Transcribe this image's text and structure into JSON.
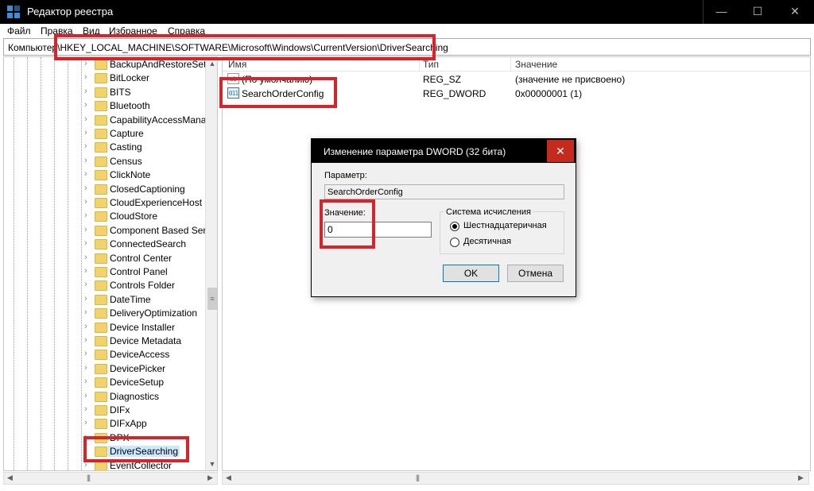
{
  "window": {
    "title": "Редактор реестра",
    "min_icon": "—",
    "max_icon": "☐",
    "close_icon": "✕"
  },
  "menu": {
    "items": [
      "Файл",
      "Правка",
      "Вид",
      "Избранное",
      "Справка"
    ]
  },
  "address": {
    "path": "Компьютер\\HKEY_LOCAL_MACHINE\\SOFTWARE\\Microsoft\\Windows\\CurrentVersion\\DriverSearching"
  },
  "tree": {
    "items": [
      "BackupAndRestoreSetti",
      "BitLocker",
      "BITS",
      "Bluetooth",
      "CapabilityAccessManag",
      "Capture",
      "Casting",
      "Census",
      "ClickNote",
      "ClosedCaptioning",
      "CloudExperienceHost",
      "CloudStore",
      "Component Based Serv",
      "ConnectedSearch",
      "Control Center",
      "Control Panel",
      "Controls Folder",
      "DateTime",
      "DeliveryOptimization",
      "Device Installer",
      "Device Metadata",
      "DeviceAccess",
      "DevicePicker",
      "DeviceSetup",
      "Diagnostics",
      "DIFx",
      "DIFxApp",
      "DPX",
      "DriverSearching",
      "EventCollector"
    ],
    "selected": "DriverSearching"
  },
  "list": {
    "columns": {
      "name": "Имя",
      "type": "Тип",
      "value": "Значение"
    },
    "rows": [
      {
        "icon": "ab",
        "name": "(По умолчанию)",
        "type": "REG_SZ",
        "value": "(значение не присвоено)"
      },
      {
        "icon": "011\n110",
        "name": "SearchOrderConfig",
        "type": "REG_DWORD",
        "value": "0x00000001 (1)"
      }
    ]
  },
  "dialog": {
    "title": "Изменение параметра DWORD (32 бита)",
    "close_icon": "✕",
    "param_label": "Параметр:",
    "param_value": "SearchOrderConfig",
    "value_label": "Значение:",
    "value_input": "0",
    "radix_label": "Система исчисления",
    "radix_hex": "Шестнадцатеричная",
    "radix_dec": "Десятичная",
    "ok": "OK",
    "cancel": "Отмена"
  },
  "colors": {
    "highlight": "#d8232a",
    "titlebar": "#000000",
    "folder": "#f2d36b",
    "selection": "#cce8ff"
  }
}
